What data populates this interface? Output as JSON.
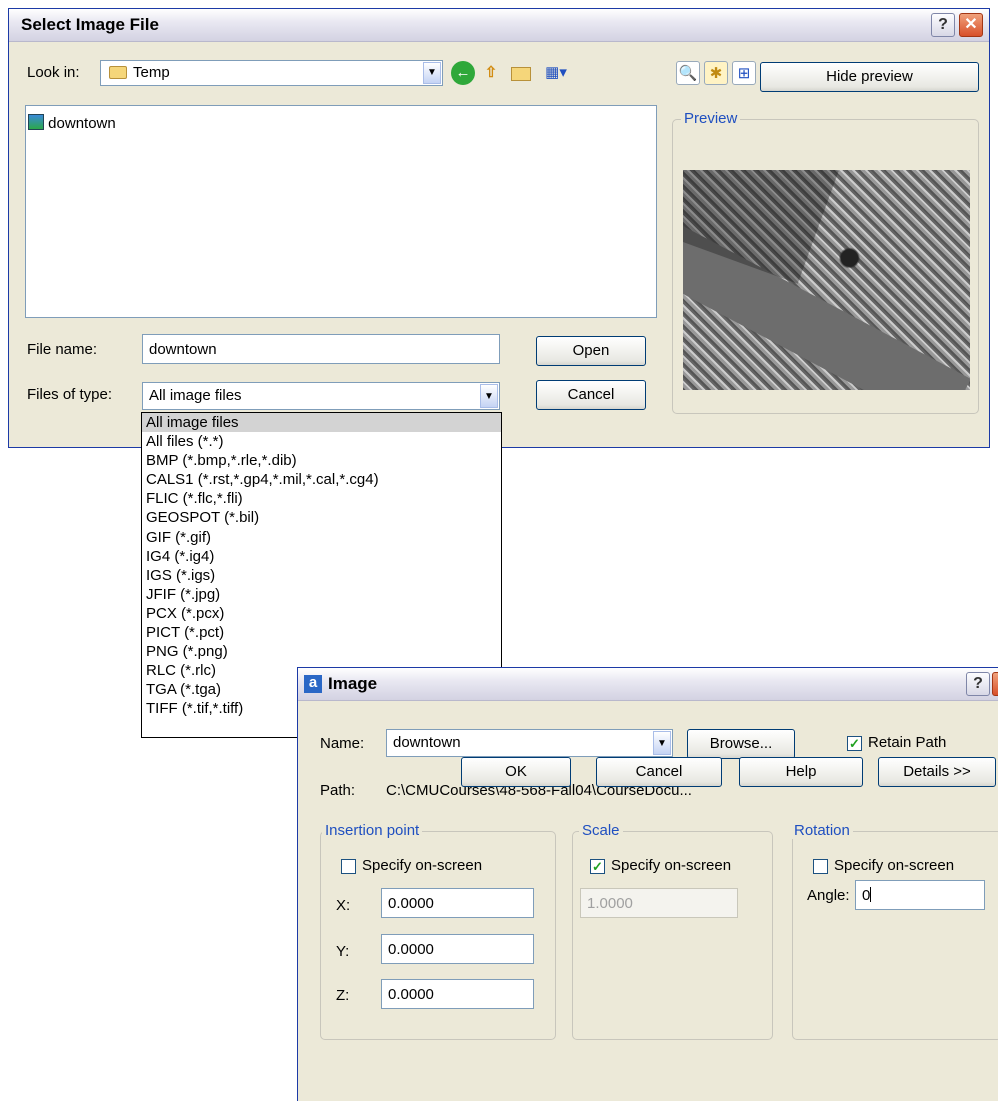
{
  "select_dialog": {
    "title": "Select Image File",
    "look_in_label": "Look in:",
    "look_in_value": "Temp",
    "hide_preview_label": "Hide preview",
    "files": [
      {
        "name": "downtown",
        "icon": "image-file-icon"
      }
    ],
    "preview_label": "Preview",
    "file_name_label": "File name:",
    "file_name_value": "downtown",
    "files_of_type_label": "Files of type:",
    "files_of_type_value": "All image files",
    "open_label": "Open",
    "cancel_label": "Cancel",
    "file_type_options": [
      "All image files",
      "All files (*.*)",
      "BMP (*.bmp,*.rle,*.dib)",
      "CALS1 (*.rst,*.gp4,*.mil,*.cal,*.cg4)",
      "FLIC (*.flc,*.fli)",
      "GEOSPOT (*.bil)",
      "GIF (*.gif)",
      "IG4 (*.ig4)",
      "IGS (*.igs)",
      "JFIF (*.jpg)",
      "PCX (*.pcx)",
      "PICT (*.pct)",
      "PNG (*.png)",
      "RLC (*.rlc)",
      "TGA (*.tga)",
      "TIFF (*.tif,*.tiff)"
    ]
  },
  "image_dialog": {
    "app_icon_letter": "a",
    "title": "Image",
    "name_label": "Name:",
    "name_value": "downtown",
    "browse_label": "Browse...",
    "retain_path_label": "Retain Path",
    "retain_path_checked": true,
    "path_label": "Path:",
    "path_value": "C:\\CMUCourses\\48-568-Fall04\\CourseDocu...",
    "insertion_point": {
      "legend": "Insertion point",
      "specify_label": "Specify on-screen",
      "x_label": "X:",
      "x_value": "0.0000",
      "y_label": "Y:",
      "y_value": "0.0000",
      "z_label": "Z:",
      "z_value": "0.0000"
    },
    "scale": {
      "legend": "Scale",
      "specify_label": "Specify on-screen",
      "value": "1.0000"
    },
    "rotation": {
      "legend": "Rotation",
      "specify_label": "Specify on-screen",
      "angle_label": "Angle:",
      "angle_value": "0"
    },
    "ok_label": "OK",
    "cancel_label": "Cancel",
    "help_label": "Help",
    "details_label": "Details >>"
  },
  "colors": {
    "dialog_bg": "#ece9d8",
    "legend_blue": "#1f4fc0",
    "title_gradient": "#d3d2e2",
    "close_red": "#d8502a"
  }
}
